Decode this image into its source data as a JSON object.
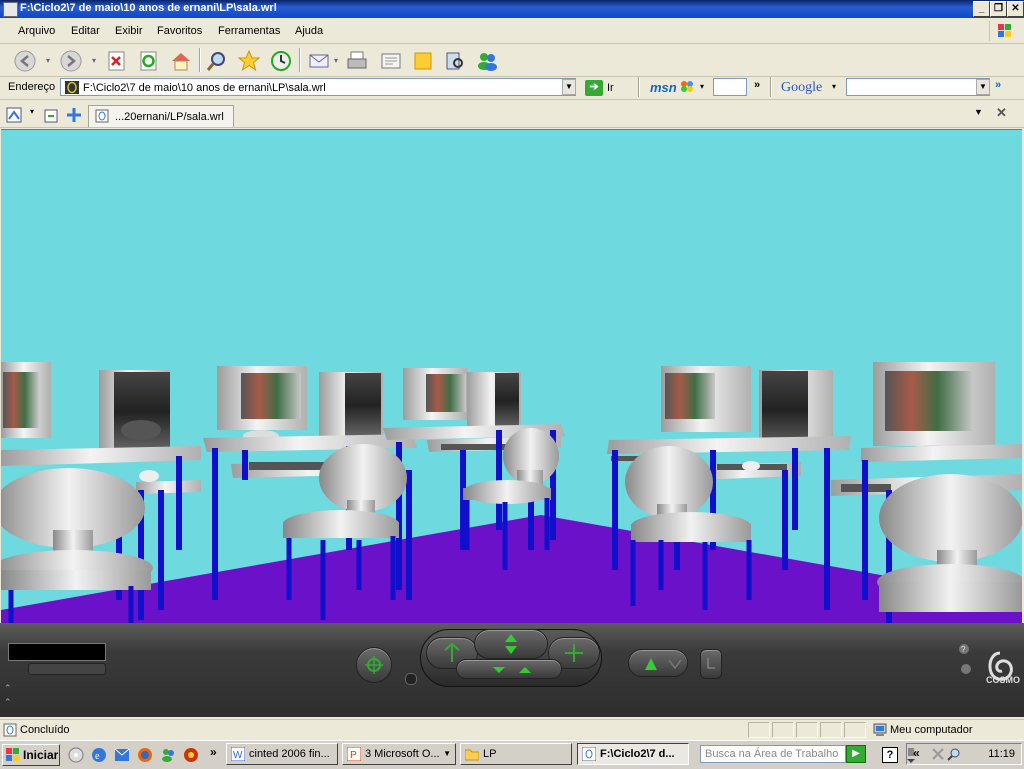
{
  "window": {
    "title": "F:\\Ciclo2\\7 de maio\\10 anos de ernani\\LP\\sala.wrl"
  },
  "menu": [
    "Arquivo",
    "Editar",
    "Exibir",
    "Favoritos",
    "Ferramentas",
    "Ajuda"
  ],
  "address": {
    "label": "Endereço",
    "value": "F:\\Ciclo2\\7 de maio\\10 anos de ernani\\LP\\sala.wrl",
    "go_label": "Ir",
    "msn_label": "msn",
    "google_label": "Google"
  },
  "tab": {
    "label": "...20ernani/LP/sala.wrl"
  },
  "cosmo": {
    "logo_text": "COSMO"
  },
  "status": {
    "left_text": "Concluído",
    "right_text": "Meu computador"
  },
  "taskbar": {
    "start_label": "Iniciar",
    "tasks": [
      {
        "label": "cinted 2006 fin...",
        "icon": "word-doc-icon"
      },
      {
        "label": "3 Microsoft O...",
        "icon": "powerpoint-icon"
      },
      {
        "label": "LP",
        "icon": "folder-icon"
      },
      {
        "label": "F:\\Ciclo2\\7 d...",
        "icon": "ie-page-icon"
      }
    ],
    "search_placeholder": "Busca na Área de Trabalho",
    "clock": "11:19"
  },
  "colors": {
    "sky": "#6ed9de",
    "floor": "#6a11c9",
    "legs": "#1010cc"
  }
}
